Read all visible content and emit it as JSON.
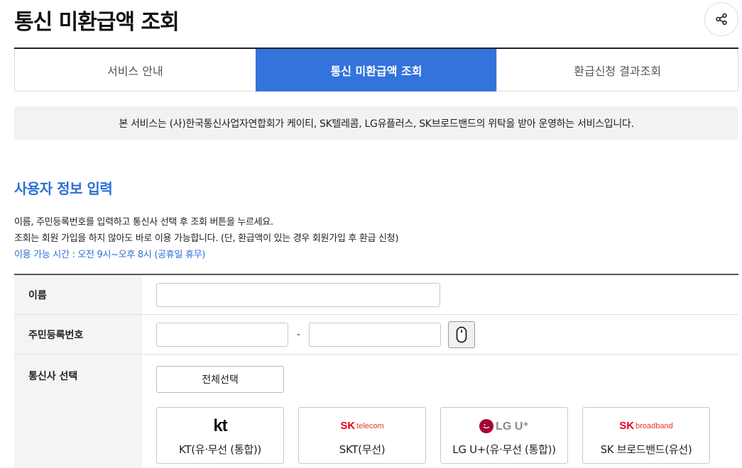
{
  "page": {
    "title": "통신 미환급액 조회",
    "share_icon": "share-icon"
  },
  "tabs": [
    {
      "label": "서비스 안내",
      "active": false
    },
    {
      "label": "통신 미환급액 조회",
      "active": true
    },
    {
      "label": "환급신청 결과조회",
      "active": false
    }
  ],
  "notice": "본 서비스는 (사)한국통신사업자연합회가 케이티, SK텔레콤, LG유플러스, SK브로드밴드의 위탁을 받아 운영하는 서비스입니다.",
  "section": {
    "title": "사용자 정보 입력",
    "desc1": "이름, 주민등록번호를 입력하고 통신사 선택 후 조회 버튼을 누르세요.",
    "desc2": "조회는 회원 가입을 하지 않아도 바로 이용 가능합니다. (단, 환급액이 있는 경우 회원가입 후 환급 신청)",
    "desc3": "이용 가능 시간 : 오전 9시~오후 8시 (공휴일 휴무)"
  },
  "form": {
    "name_label": "이름",
    "name_value": "",
    "rrn_label": "주민등록번호",
    "rrn_front_value": "",
    "rrn_back_value": "",
    "rrn_separator": "-",
    "carrier_label": "통신사 선택",
    "select_all_label": "전체선택"
  },
  "carriers": [
    {
      "logo_text": "kt",
      "name": "KT(유·무선 (통합))"
    },
    {
      "logo_mark": "SK",
      "logo_sub": "telecom",
      "name": "SKT(무선)"
    },
    {
      "logo_text": "LG U⁺",
      "name": "LG U+(유·무선 (통합))"
    },
    {
      "logo_mark": "SK",
      "logo_sub": "broadband",
      "name": "SK 브로드밴드(유선)"
    }
  ],
  "colors": {
    "accent": "#3273dc",
    "section_title": "#2d6fd6",
    "sk_red": "#e8001c",
    "lg_magenta": "#a50034"
  }
}
